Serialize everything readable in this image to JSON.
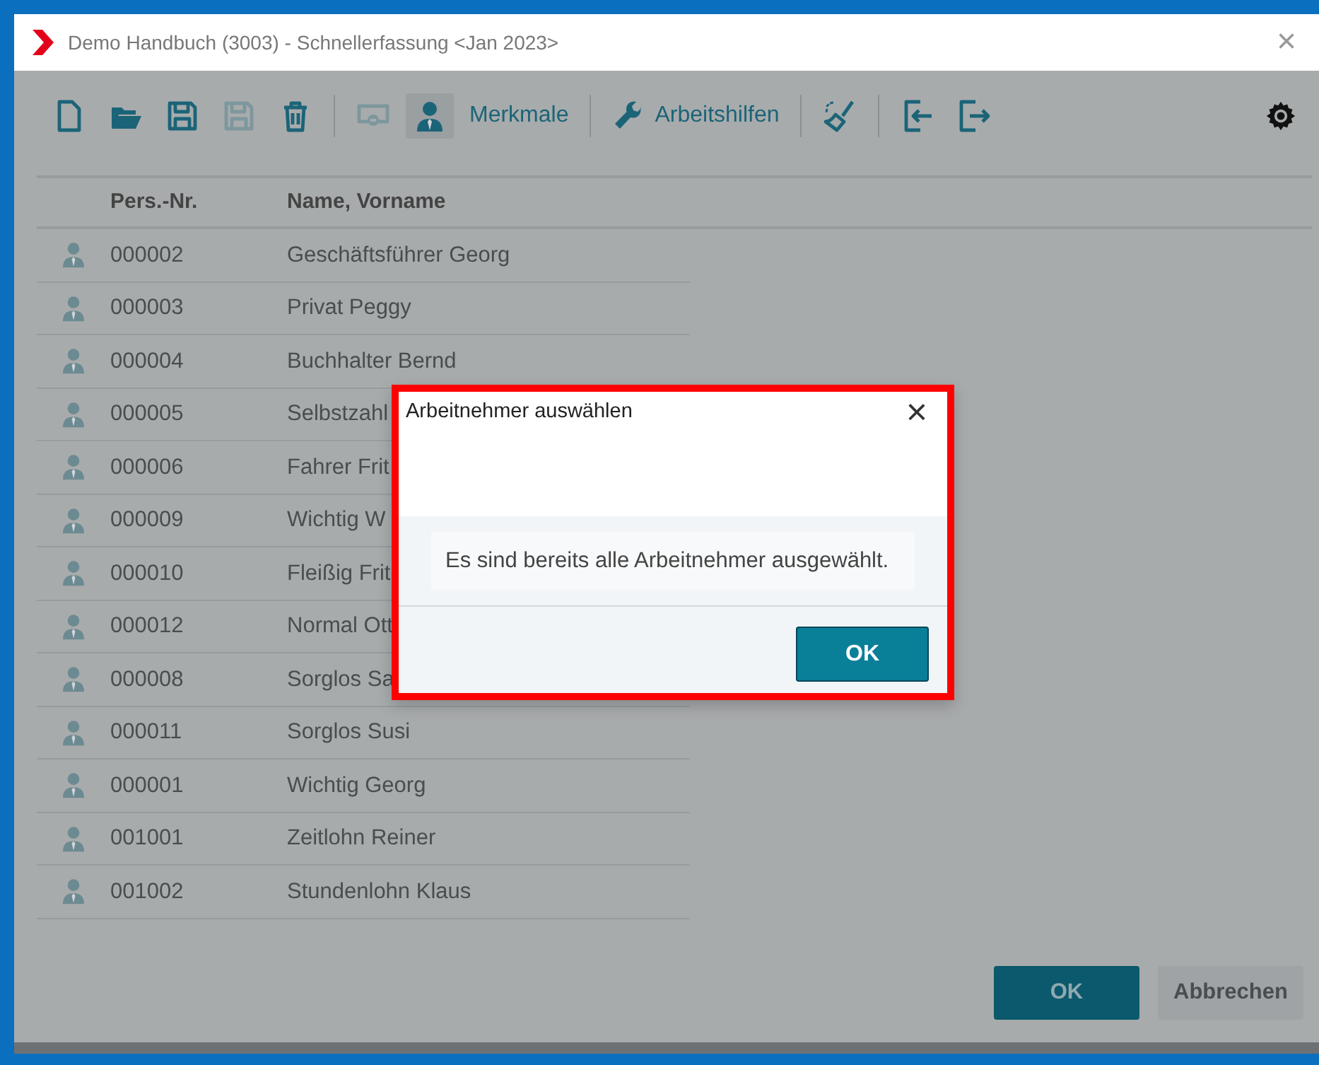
{
  "window": {
    "title": "Demo Handbuch (3003) - Schnellerfassung <Jan 2023>",
    "close": "×"
  },
  "toolbar": [
    {
      "kind": "new",
      "disabled": false,
      "selected": false
    },
    {
      "kind": "open",
      "disabled": false,
      "selected": false
    },
    {
      "kind": "save",
      "disabled": false,
      "selected": false
    },
    {
      "kind": "save",
      "disabled": true,
      "selected": false
    },
    {
      "kind": "delete",
      "disabled": false,
      "selected": false
    },
    {
      "kind": "separator"
    },
    {
      "kind": "remove",
      "disabled": true,
      "selected": false
    },
    {
      "kind": "person",
      "disabled": false,
      "selected": true
    },
    {
      "kind": "text",
      "label": "Merkmale",
      "disabled": false,
      "selected": false
    },
    {
      "kind": "separator"
    },
    {
      "kind": "wrench",
      "label": "Arbeitshilfen",
      "disabled": false,
      "selected": false
    },
    {
      "kind": "separator"
    },
    {
      "kind": "clean",
      "disabled": false,
      "selected": false
    },
    {
      "kind": "separator"
    },
    {
      "kind": "import",
      "disabled": false,
      "selected": false
    },
    {
      "kind": "export",
      "disabled": false,
      "selected": false
    }
  ],
  "table": {
    "columns": [
      "Pers.-Nr.",
      "Name, Vorname"
    ],
    "rows": [
      {
        "number": "000002",
        "name": "Geschäftsführer Georg"
      },
      {
        "number": "000003",
        "name": "Privat Peggy"
      },
      {
        "number": "000004",
        "name": "Buchhalter Bernd"
      },
      {
        "number": "000005",
        "name": "Selbstzahl"
      },
      {
        "number": "000006",
        "name": "Fahrer Frit"
      },
      {
        "number": "000009",
        "name": "Wichtig W"
      },
      {
        "number": "000010",
        "name": "Fleißig Frit"
      },
      {
        "number": "000012",
        "name": "Normal Ott"
      },
      {
        "number": "000008",
        "name": "Sorglos Sa"
      },
      {
        "number": "000011",
        "name": "Sorglos Susi"
      },
      {
        "number": "000001",
        "name": "Wichtig Georg"
      },
      {
        "number": "001001",
        "name": "Zeitlohn Reiner"
      },
      {
        "number": "001002",
        "name": "Stundenlohn Klaus"
      }
    ]
  },
  "buttons": [
    {
      "label": "OK",
      "kind": "primary"
    },
    {
      "label": "Abbrechen",
      "kind": "secondary"
    }
  ],
  "dialog": {
    "title": "Arbeitnehmer auswählen",
    "close": "×",
    "message": "Es sind bereits alle Arbeitnehmer ausgewählt.",
    "ok": "OK"
  }
}
